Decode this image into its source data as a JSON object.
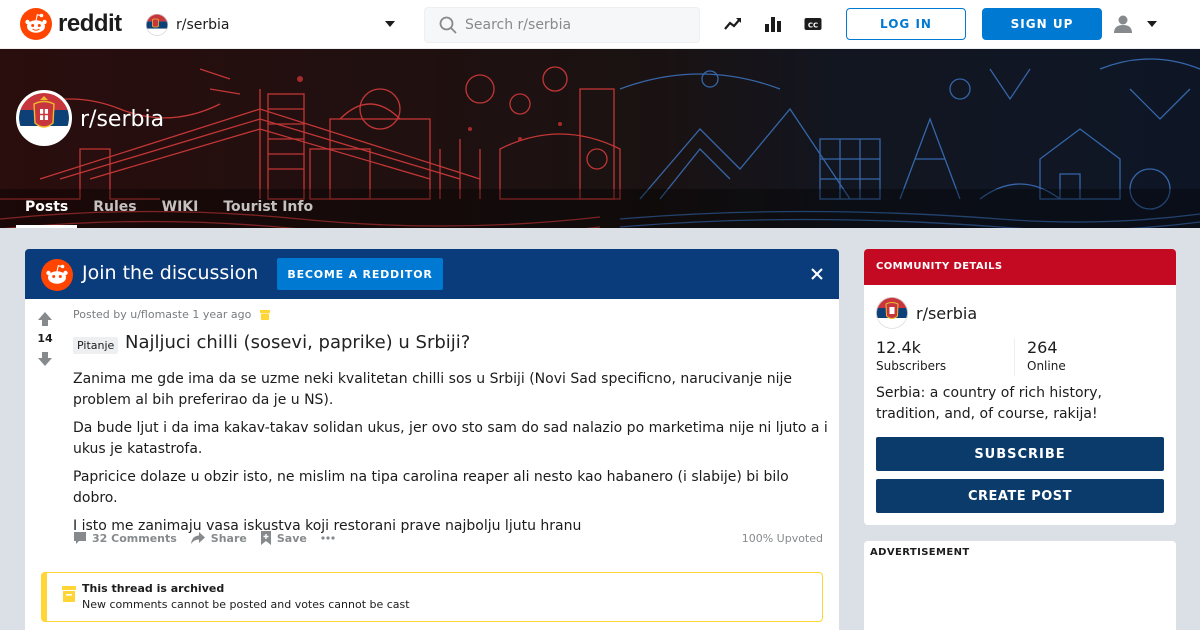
{
  "header": {
    "brand": "reddit",
    "subreddit": "r/serbia",
    "search_placeholder": "Search r/serbia",
    "login_label": "LOG IN",
    "signup_label": "SIGN UP",
    "icons": [
      "trending-icon",
      "leaderboard-icon",
      "closed-captions-icon",
      "user-icon",
      "chevron-down-icon"
    ]
  },
  "banner": {
    "title": "r/serbia",
    "tabs": [
      {
        "label": "Posts",
        "active": true
      },
      {
        "label": "Rules",
        "active": false
      },
      {
        "label": "WIKI",
        "active": false
      },
      {
        "label": "Tourist Info",
        "active": false
      }
    ]
  },
  "join": {
    "text": "Join the discussion",
    "button": "BECOME A REDDITOR"
  },
  "post": {
    "votes": "14",
    "posted_by": "Posted by u/flomaste 1 year ago",
    "flair": "Pitanje",
    "title": "Najljuci chilli (sosevi, paprike) u Srbiji?",
    "body": [
      "Zanima me gde ima da se uzme neki kvalitetan chilli sos u Srbiji (Novi Sad specificno, narucivanje nije problem al bih preferirao da je u NS).",
      "Da bude ljut i da ima kakav-takav solidan ukus, jer ovo sto sam do sad nalazio po marketima nije ni ljuto a i ukus je katastrofa.",
      "Papricice dolaze u obzir isto, ne mislim na tipa carolina reaper ali nesto kao habanero (i slabije) bi bilo dobro.",
      "I isto me zanimaju vasa iskustva koji restorani prave najbolju ljutu hranu"
    ],
    "comments": "32 Comments",
    "share": "Share",
    "save": "Save",
    "upvoted": "100% Upvoted",
    "archived_title": "This thread is archived",
    "archived_text": "New comments cannot be posted and votes cannot be cast"
  },
  "community": {
    "header": "COMMUNITY DETAILS",
    "name": "r/serbia",
    "subscribers": "12.4k",
    "subscribers_label": "Subscribers",
    "online": "264",
    "online_label": "Online",
    "description": "Serbia: a country of rich history, tradition, and, of course, rakija!",
    "subscribe_label": "SUBSCRIBE",
    "create_post_label": "CREATE POST"
  },
  "ad": {
    "label": "ADVERTISEMENT"
  },
  "colors": {
    "reddit_orange": "#ff4500",
    "reddit_blue": "#0079d3",
    "join_bar": "#0a3b7a",
    "community_red": "#c40a22",
    "sidebar_button": "#0a3b6a",
    "archived_yellow": "#ffd635"
  }
}
